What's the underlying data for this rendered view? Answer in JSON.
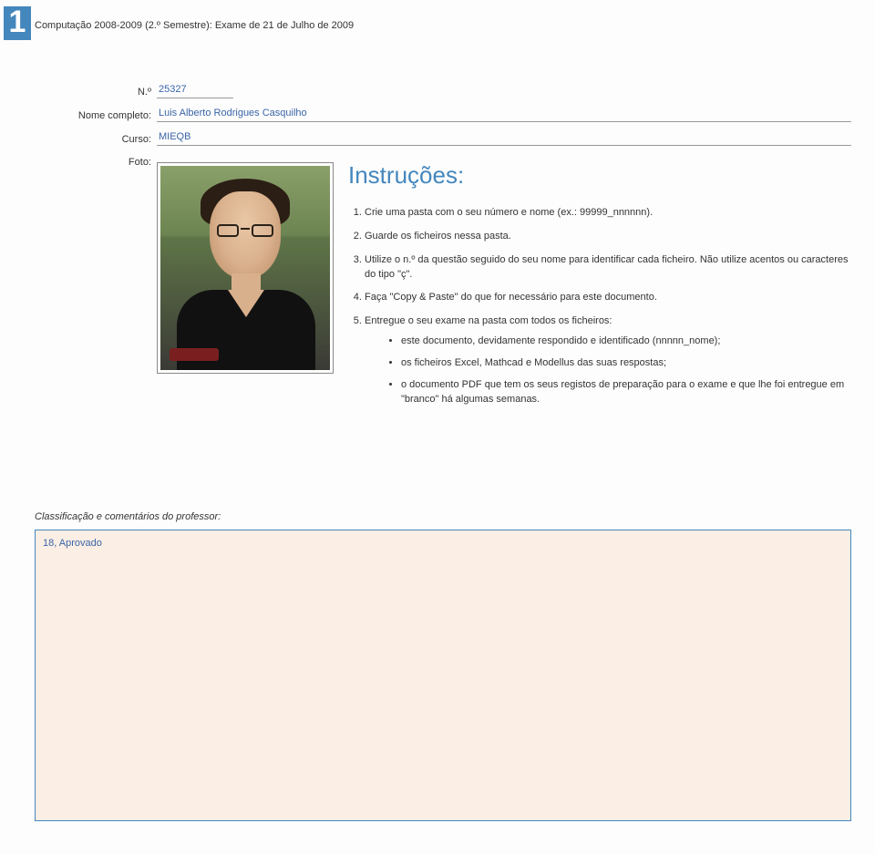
{
  "page_number": "1",
  "header": "Computação 2008-2009 (2.º Semestre): Exame de 21 de Julho de 2009",
  "form": {
    "labels": {
      "numero": "N.º",
      "nome": "Nome completo:",
      "curso": "Curso:",
      "foto": "Foto:"
    },
    "values": {
      "numero": "25327",
      "nome": "Luis Alberto Rodrigues Casquilho",
      "curso": "MIEQB"
    }
  },
  "instructions": {
    "heading": "Instruções:",
    "items": [
      "Crie uma pasta com o seu número e nome (ex.: 99999_nnnnnn).",
      "Guarde os ficheiros nessa pasta.",
      "Utilize o n.º da questão seguido do seu nome para identificar cada ficheiro. Não utilize acentos ou caracteres do tipo \"ç\".",
      "Faça \"Copy & Paste\" do que for necessário para este documento.",
      "Entregue o seu exame na pasta com todos os ficheiros:"
    ],
    "sub_items": [
      "este documento, devidamente respondido e identificado (nnnnn_nome);",
      "os ficheiros Excel, Mathcad e Modellus das suas respostas;",
      "o documento PDF que tem os seus registos de preparação para o exame e que lhe foi entregue em \"branco\" há algumas semanas."
    ]
  },
  "comments": {
    "label": "Classificação e comentários do professor:",
    "value": "18, Aprovado"
  }
}
